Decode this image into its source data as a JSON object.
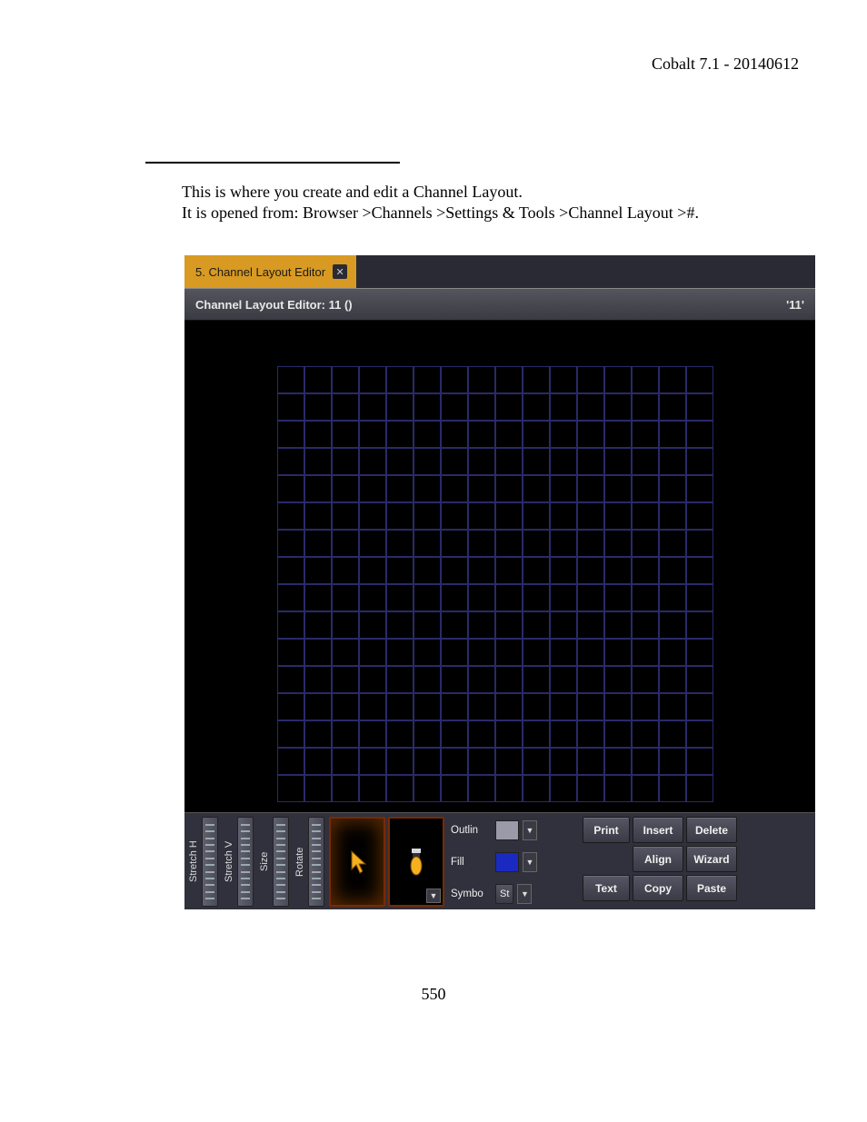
{
  "doc": {
    "header_right": "Cobalt 7.1 - 20140612",
    "intro_line1": "This is where you create and edit a Channel Layout.",
    "intro_line2": "It is opened from: Browser >Channels >Settings & Tools >Channel Layout >#.",
    "page_number": "550"
  },
  "app": {
    "tab_title": "5. Channel Layout Editor",
    "subhead_left": "Channel Layout Editor: 11 ()",
    "subhead_right": "'11'",
    "sliders": [
      {
        "label": "Stretch H"
      },
      {
        "label": "Stretch V"
      },
      {
        "label": "Size"
      },
      {
        "label": "Rotate"
      }
    ],
    "props": {
      "outline_label": "Outlin",
      "fill_label": "Fill",
      "symbol_label": "Symbo",
      "symbol_value": "St"
    },
    "buttons": {
      "print": "Print",
      "insert": "Insert",
      "delete": "Delete",
      "align": "Align",
      "wizard": "Wizard",
      "text": "Text",
      "copy": "Copy",
      "paste": "Paste"
    },
    "grid": {
      "cols": 16,
      "rows": 16
    }
  }
}
